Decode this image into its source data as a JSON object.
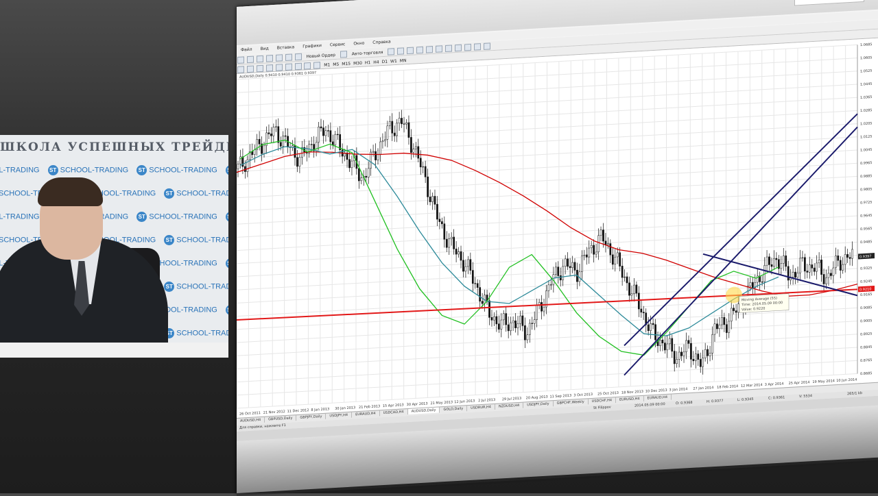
{
  "presenter": {
    "banner_title": "ШКОЛА УСПЕШНЫХ ТРЕЙДЕ",
    "watermark_text": "SCHOOL-TRADING",
    "watermark_logo": "ST"
  },
  "window": {
    "menu": [
      "Файл",
      "Вид",
      "Вставка",
      "Графики",
      "Сервис",
      "Окно",
      "Справка"
    ],
    "toolbar_labels": [
      "Новый Ордер",
      "Авто-торговля"
    ],
    "timeframes": [
      "M1",
      "M5",
      "M15",
      "M30",
      "H1",
      "H4",
      "D1",
      "W1",
      "MN"
    ],
    "chart_caption": "AUDUSD,Daily  0.9410 0.9410 0.9361 0.9397",
    "tabs": [
      "AUDUSD,H4",
      "GBPUSD,Daily",
      "GBPJPY,Daily",
      "USDJPY,H4",
      "EURAUD,H4",
      "USDCAD,H4",
      "AUDUSD,Daily",
      "GOLD,Daily",
      "USDRUR,H4",
      "NZDUSD,H4",
      "USDJPY,Daily",
      "GBPCHF,Weekly",
      "USDCHF,H4",
      "EURUSD,H4",
      "EURAUD,H4"
    ],
    "status_left": "Для справки, нажмите F1",
    "status_profile": "St Filippov",
    "status_time": "2014.05.09 00:00",
    "status_o": "O: 0.9368",
    "status_h": "H: 0.9377",
    "status_l": "L: 0.9345",
    "status_c": "C: 0.9361",
    "status_v": "V: 5534",
    "status_traffic": "265/1 kb"
  },
  "chart_data": {
    "type": "line",
    "symbol": "AUDUSD,Daily",
    "x_ticks": [
      "26 Oct 2011",
      "21 Nov 2012",
      "11 Dec 2012",
      "8 Jan 2013",
      "30 Jan 2013",
      "21 Feb 2013",
      "15 Apr 2013",
      "30 Apr 2013",
      "21 May 2013",
      "12 Jun 2013",
      "2 Jul 2013",
      "29 Jul 2013",
      "20 Aug 2013",
      "11 Sep 2013",
      "3 Oct 2013",
      "25 Oct 2013",
      "18 Nov 2013",
      "10 Dec 2013",
      "3 Jan 2014",
      "27 Jan 2014",
      "18 Feb 2014",
      "12 Mar 2014",
      "3 Apr 2014",
      "25 Apr 2014",
      "19 May 2014",
      "10 Jun 2014"
    ],
    "y_ticks": [
      "1.0685",
      "1.0605",
      "1.0525",
      "1.0445",
      "1.0365",
      "1.0285",
      "1.0205",
      "1.0125",
      "1.0045",
      "0.9965",
      "0.9885",
      "0.9805",
      "0.9725",
      "0.9645",
      "0.9565",
      "0.9485",
      "0.9405",
      "0.9325",
      "0.9245",
      "0.9165",
      "0.9085",
      "0.9005",
      "0.8925",
      "0.8845",
      "0.8765",
      "0.8685"
    ],
    "ylim": [
      0.8685,
      1.0685
    ],
    "current_price": "0.9397",
    "hline_price": "0.9210",
    "price_close_approx": [
      1.014,
      1.022,
      1.03,
      1.036,
      1.026,
      1.018,
      1.028,
      1.035,
      1.025,
      1.014,
      1.004,
      1.02,
      1.032,
      1.038,
      1.022,
      1.0,
      0.975,
      0.96,
      0.95,
      0.935,
      0.918,
      0.91,
      0.912,
      0.905,
      0.918,
      0.935,
      0.945,
      0.94,
      0.952,
      0.96,
      0.948,
      0.932,
      0.918,
      0.9,
      0.893,
      0.885,
      0.89,
      0.878,
      0.9,
      0.905,
      0.913,
      0.925,
      0.935,
      0.942,
      0.93,
      0.936,
      0.935,
      0.928,
      0.938,
      0.94
    ],
    "series": [
      {
        "name": "",
        "color": "#d00000",
        "values": [
          1.012,
          1.016,
          1.02,
          1.022,
          1.021,
          1.019,
          1.018,
          1.018,
          1.016,
          1.012,
          1.005,
          0.997,
          0.988,
          0.978,
          0.967,
          0.958,
          0.952,
          0.949,
          0.944,
          0.938,
          0.932,
          0.927,
          0.922,
          0.918,
          0.918,
          0.92,
          0.923
        ]
      },
      {
        "name": "",
        "color": "#2e8b9a",
        "values": [
          1.016,
          1.022,
          1.026,
          1.024,
          1.02,
          1.022,
          1.012,
          0.992,
          0.97,
          0.95,
          0.935,
          0.925,
          0.923,
          0.93,
          0.937,
          0.938,
          0.925,
          0.912,
          0.9,
          0.898,
          0.902,
          0.91,
          0.918,
          0.925,
          0.93
        ]
      },
      {
        "name": "",
        "color": "#22c022",
        "values": [
          1.02,
          1.028,
          1.03,
          1.022,
          1.026,
          1.02,
          0.99,
          0.96,
          0.935,
          0.918,
          0.912,
          0.925,
          0.945,
          0.952,
          0.935,
          0.915,
          0.9,
          0.89,
          0.887,
          0.9,
          0.915,
          0.93,
          0.935,
          0.93,
          0.936
        ]
      }
    ],
    "tooltip": [
      "Moving Average (55)",
      "Time: 2014.05.09 00:00",
      "Value: 0.9220"
    ],
    "grid": true
  },
  "colors": {
    "hline": "#e21818",
    "trendline": "#1a1a6b",
    "price_label_bg": "#e21818"
  }
}
